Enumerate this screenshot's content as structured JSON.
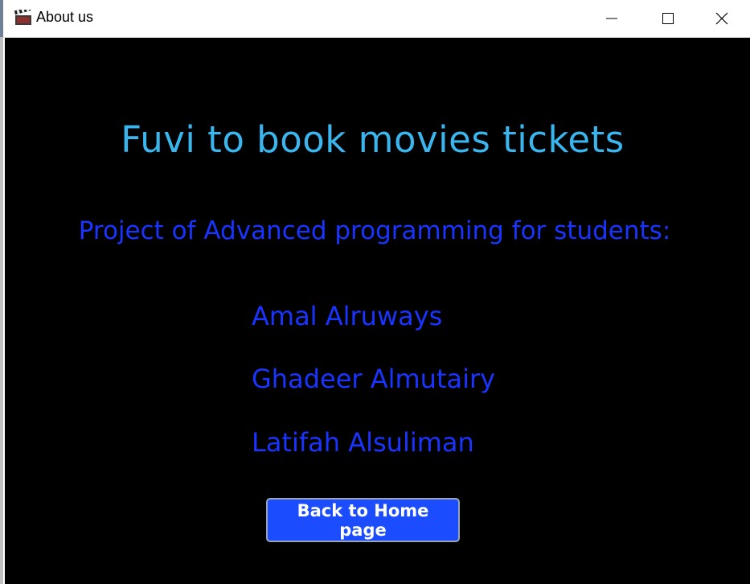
{
  "window": {
    "title": "About us",
    "app_icon": "clapperboard-icon",
    "controls": {
      "minimize_icon": "minimize-icon",
      "maximize_icon": "maximize-icon",
      "close_icon": "close-icon"
    }
  },
  "about": {
    "heading": "Fuvi to book movies tickets",
    "subheading": "Project of Advanced programming for students:",
    "students": [
      "Amal Alruways",
      "Ghadeer Almutairy",
      "Latifah Alsuliman"
    ],
    "back_button_label": "Back to Home page"
  },
  "colors": {
    "background": "#000000",
    "heading": "#3ab6ee",
    "text": "#1a34ff",
    "button": "#1b4dff",
    "button_text": "#ffffff"
  }
}
